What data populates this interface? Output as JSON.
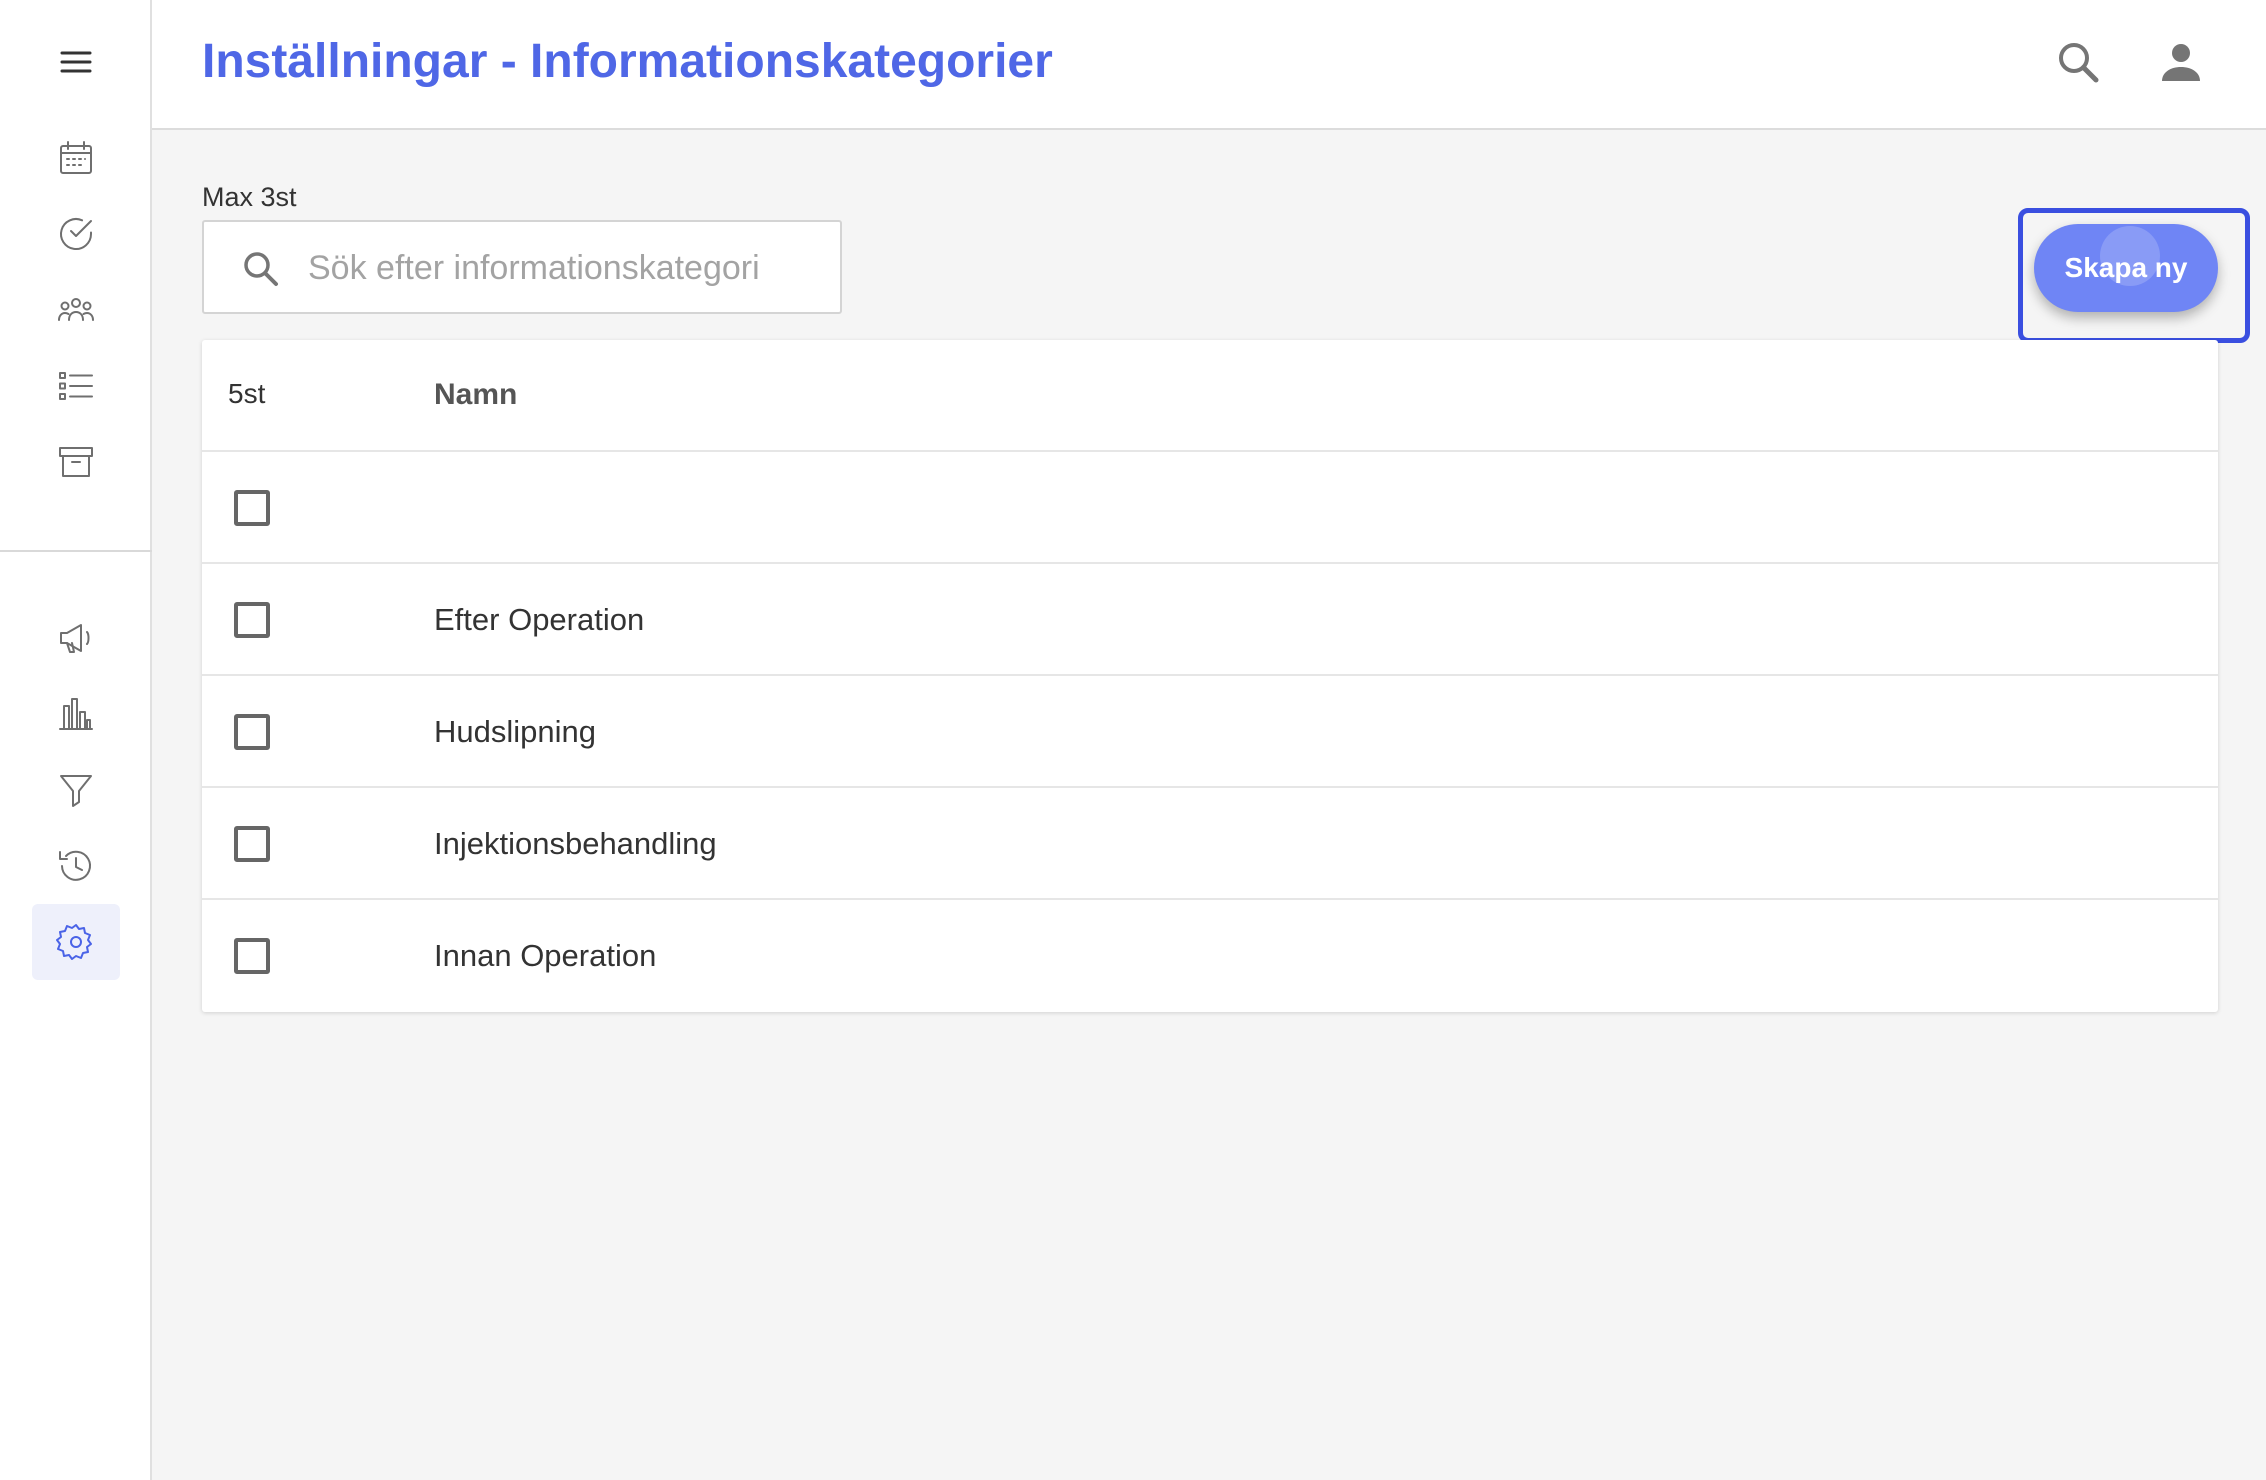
{
  "header": {
    "title": "Inställningar - Informationskategorier"
  },
  "sidebar": {
    "top_items": [
      "menu-icon",
      "calendar-icon",
      "check-circle-icon",
      "group-icon",
      "list-icon",
      "archive-icon"
    ],
    "bottom_items": [
      "megaphone-icon",
      "bar-chart-icon",
      "filter-icon",
      "history-icon",
      "settings-icon"
    ],
    "active_item": "settings-icon"
  },
  "search": {
    "label": "Max 3st",
    "placeholder": "Sök efter informationskategori",
    "value": ""
  },
  "actions": {
    "create_label": "Skapa ny"
  },
  "table": {
    "count_label": "5st",
    "name_header": "Namn",
    "rows": [
      {
        "name": "",
        "checked": false
      },
      {
        "name": "Efter Operation",
        "checked": false
      },
      {
        "name": "Hudslipning",
        "checked": false
      },
      {
        "name": "Injektionsbehandling",
        "checked": false
      },
      {
        "name": "Innan Operation",
        "checked": false
      }
    ]
  },
  "colors": {
    "accent": "#4f67e6",
    "button": "#6f85f5",
    "highlight_frame": "#3a4fe0"
  }
}
